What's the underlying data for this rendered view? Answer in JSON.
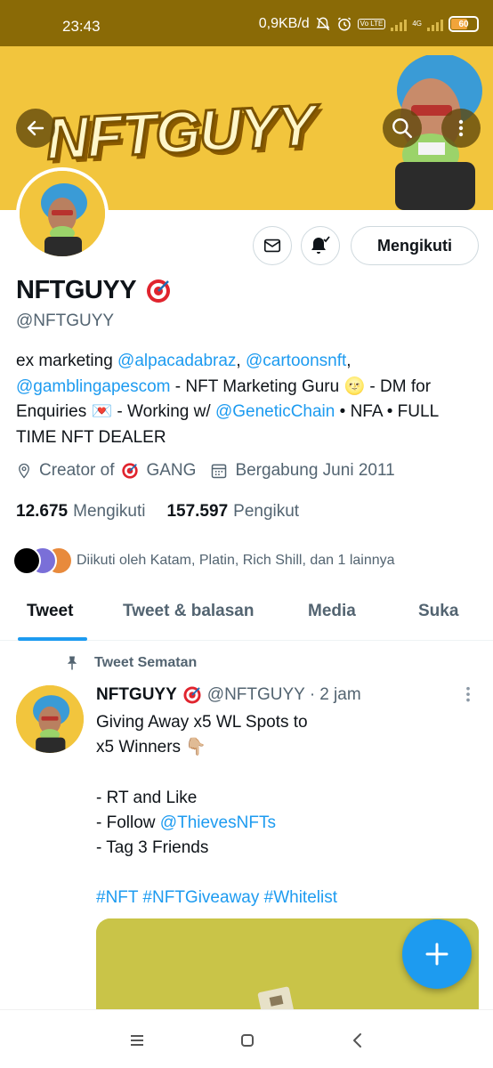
{
  "status_bar": {
    "time": "23:43",
    "network_speed": "0,9KB/d",
    "volte": "Vo LTE",
    "network_type": "4G",
    "battery": "60"
  },
  "banner": {
    "logo_text": "NFTGUYY",
    "background_color": "#f2c53d"
  },
  "header_actions": {
    "back_icon": "arrow-left-icon",
    "search_icon": "search-icon",
    "more_icon": "more-vertical-icon"
  },
  "profile": {
    "display_name": "NFTGUYY",
    "name_emoji": "target-emoji",
    "handle": "@NFTGUYY",
    "follow_label": "Mengikuti",
    "bio": {
      "t1": "ex marketing ",
      "l1": "@alpacadabraz",
      "t2": ", ",
      "l2": "@cartoonsnft",
      "t3": ", ",
      "l3": "@gamblingapescom",
      "t4": " - NFT Marketing Guru 🌝 - DM for Enquiries 💌 - Working w/ ",
      "l4": "@GeneticChain",
      "t5": " • NFA • FULL TIME NFT DEALER"
    },
    "location_prefix": "Creator of",
    "location_suffix": "GANG",
    "joined": "Bergabung Juni 2011",
    "following_count": "12.675",
    "following_label": "Mengikuti",
    "followers_count": "157.597",
    "followers_label": "Pengikut",
    "followed_by": "Diikuti oleh Katam, Platin, Rich Shill, dan 1 lainnya"
  },
  "tabs": [
    {
      "label": "Tweet",
      "active": true
    },
    {
      "label": "Tweet & balasan",
      "active": false
    },
    {
      "label": "Media",
      "active": false
    },
    {
      "label": "Suka",
      "active": false
    }
  ],
  "pinned_tweet": {
    "pinned_label": "Tweet Sematan",
    "author_name": "NFTGUYY",
    "author_handle": "@NFTGUYY",
    "separator": "·",
    "time": "2 jam",
    "line1": "Giving Away x5 WL Spots to",
    "line2": "x5 Winners 👇🏼",
    "line3": "- RT and Like",
    "line4_prefix": "- Follow ",
    "line4_link": "@ThievesNFTs",
    "line5": "- Tag 3 Friends",
    "hashtags": "#NFT #NFTGiveaway #Whitelist"
  },
  "colors": {
    "accent": "#1d9bf0",
    "status_bar": "#8a6a06",
    "secondary_text": "#536471"
  }
}
